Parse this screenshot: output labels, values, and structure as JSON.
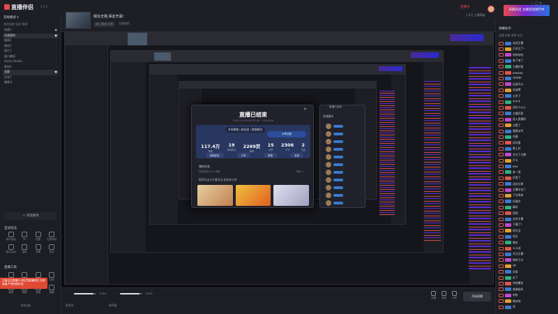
{
  "app": {
    "name": "直播伴侣",
    "version": "8.5.6"
  },
  "room": {
    "title": "我在无畏,保友开黑!",
    "tag": "热门游戏·开黑",
    "tag2": "无畏契约"
  },
  "header": {
    "live_badge": "直播中",
    "meta": "1.2万  主播等级",
    "banner": "庆典开启 主播活动进行中",
    "window_controls": "—  □  ✕"
  },
  "left": {
    "title": "常规模式 ▾",
    "subtitle": "我的场景  竖屏  横屏",
    "scenes": [
      {
        "label": "场景1",
        "val": "●"
      },
      {
        "label": "无畏契约",
        "val": "●"
      },
      {
        "label": "捕获1",
        "val": "◦"
      },
      {
        "label": "素材1",
        "val": "◦"
      },
      {
        "label": "图片1",
        "val": "◦"
      },
      {
        "label": "窗口捕获",
        "val": "◦"
      },
      {
        "label": "Game Studio",
        "val": "◦"
      },
      {
        "label": "素材2",
        "val": "◦"
      },
      {
        "label": "全屏",
        "val": "●"
      },
      {
        "label": "文本1",
        "val": "◦"
      },
      {
        "label": "摄像头",
        "val": "◦"
      }
    ],
    "add_scene": "+ 添加素材",
    "interact_title": "互动玩法",
    "interact_tools": [
      {
        "label": "观众连线"
      },
      {
        "label": "PK"
      },
      {
        "label": "连麦"
      },
      {
        "label": "礼物特效"
      },
      {
        "label": "观众互动"
      },
      {
        "label": "抽奖"
      },
      {
        "label": "投票"
      },
      {
        "label": "任务"
      }
    ],
    "create_title": "直播工具",
    "create_tools": [
      {
        "label": "开播设置"
      },
      {
        "label": "房管"
      },
      {
        "label": "贴纸"
      },
      {
        "label": "特效"
      },
      {
        "label": "音效"
      },
      {
        "label": "美颜"
      },
      {
        "label": "录屏"
      },
      {
        "label": "投屏"
      }
    ],
    "alert_text": "主播正在直播中,请注意直播规范,文明直播,严禁违规内容",
    "more": "更多功能"
  },
  "end_dialog": {
    "title": "直播已结束",
    "time": "2023-10-26 08:37:48 - 10:18:06",
    "tabs": "本场数据 | 粉丝团 | 数据概览",
    "share_btn": "分享战报",
    "stats": [
      {
        "value": "117.4万",
        "label": "场观"
      },
      {
        "value": "19",
        "label": "新增粉丝"
      },
      {
        "value": "2269页",
        "label": "弹幕"
      },
      {
        "value": "15",
        "label": "点赞"
      },
      {
        "value": "2306",
        "label": "人气"
      },
      {
        "value": "2",
        "label": "付费"
      }
    ],
    "actions": [
      "直播回放",
      "分享",
      "数据",
      "复盘"
    ],
    "task_title": "我的任务",
    "task_sub": "完成任务(1/2)  领取",
    "task_right": "更多 >",
    "rec_title": "推荐玩法与主播活动,快来参与吧",
    "close": "✕"
  },
  "viewer_list": {
    "title": "在线观众",
    "notice": "直播已结束"
  },
  "bottom": {
    "mic": "麦克风",
    "mic_pct": "100%",
    "speaker": "扬声器",
    "speaker_pct": "100%",
    "mic_level": 0.88,
    "speaker_level": 0.86,
    "icons": [
      "设置",
      "录制",
      "分享"
    ],
    "go_live": "开始直播"
  },
  "chat": {
    "title": "弹幕助手",
    "tabs": "全部  礼物  进场  关注",
    "messages": [
      {
        "text": "欢迎主播",
        "badge": "#3a7ad0"
      },
      {
        "text": "已关注了~",
        "badge": "#e0a030"
      },
      {
        "text": "哈哈哈哈",
        "badge": "#c04ad0"
      },
      {
        "text": "来了来了",
        "badge": "#3a7ad0"
      },
      {
        "text": "主播好强",
        "badge": "#30b080"
      },
      {
        "text": "666666",
        "badge": "#e0564a"
      },
      {
        "text": "冲冲冲!",
        "badge": "#3a7ad0"
      },
      {
        "text": "这波可以",
        "badge": "#c04ad0"
      },
      {
        "text": "加油啊",
        "badge": "#e0a030"
      },
      {
        "text": "太秀了",
        "badge": "#3a7ad0"
      },
      {
        "text": "牛牛牛",
        "badge": "#30b080"
      },
      {
        "text": "送出小心心",
        "badge": "#e0564a"
      },
      {
        "text": "主播厉害",
        "badge": "#3a7ad0"
      },
      {
        "text": "进入直播间",
        "badge": "#c04ad0"
      },
      {
        "text": "点赞了",
        "badge": "#e0a030"
      },
      {
        "text": "看看技术",
        "badge": "#3a7ad0"
      },
      {
        "text": "哇塞",
        "badge": "#30b080"
      },
      {
        "text": "好好看",
        "badge": "#e0564a"
      },
      {
        "text": "晚上好",
        "badge": "#3a7ad0"
      },
      {
        "text": "关注了主播",
        "badge": "#c04ad0"
      },
      {
        "text": "打卡",
        "badge": "#e0a030"
      },
      {
        "text": "666",
        "badge": "#3a7ad0"
      },
      {
        "text": "来一把",
        "badge": "#30b080"
      },
      {
        "text": "厉害了",
        "badge": "#e0564a"
      },
      {
        "text": "送出礼物",
        "badge": "#3a7ad0"
      },
      {
        "text": "主播辛苦了",
        "badge": "#c04ad0"
      },
      {
        "text": "下次再来",
        "badge": "#e0a030"
      },
      {
        "text": "好操作",
        "badge": "#3a7ad0"
      },
      {
        "text": "精彩",
        "badge": "#30b080"
      },
      {
        "text": "拜拜",
        "badge": "#e0564a"
      },
      {
        "text": "支持主播",
        "badge": "#3a7ad0"
      },
      {
        "text": "下播了?",
        "badge": "#c04ad0"
      },
      {
        "text": "明天见",
        "badge": "#e0a030"
      },
      {
        "text": "再见",
        "badge": "#3a7ad0"
      },
      {
        "text": "晚安",
        "badge": "#30b080"
      },
      {
        "text": "么么哒",
        "badge": "#e0564a"
      },
      {
        "text": "关注主播",
        "badge": "#3a7ad0"
      },
      {
        "text": "期待下次",
        "badge": "#c04ad0"
      },
      {
        "text": "冲!",
        "badge": "#e0a030"
      },
      {
        "text": "好耶",
        "badge": "#3a7ad0"
      },
      {
        "text": "走了",
        "badge": "#30b080"
      },
      {
        "text": "完结撒花",
        "badge": "#e0564a"
      },
      {
        "text": "感谢陪伴",
        "badge": "#3a7ad0"
      },
      {
        "text": "哈哈",
        "badge": "#c04ad0"
      },
      {
        "text": "晚安啦",
        "badge": "#e0a030"
      },
      {
        "text": "拜",
        "badge": "#3a7ad0"
      }
    ]
  }
}
